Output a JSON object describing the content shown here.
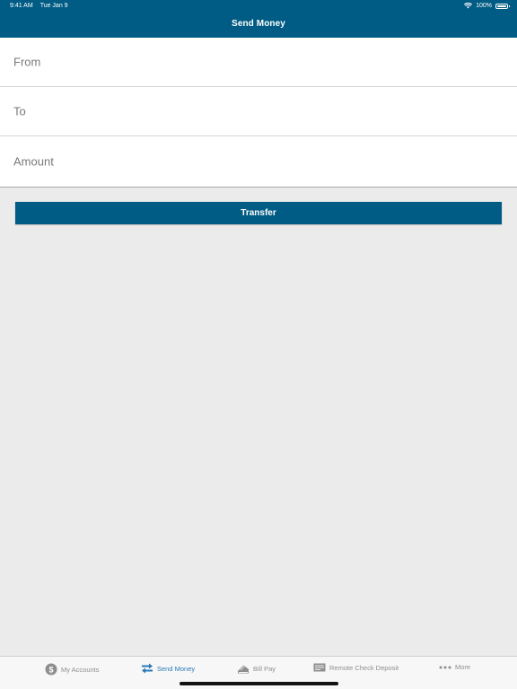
{
  "status_bar": {
    "time": "9:41 AM",
    "date": "Tue Jan 9",
    "battery": "100%"
  },
  "nav": {
    "title": "Send Money"
  },
  "form": {
    "fields": [
      {
        "label": "From"
      },
      {
        "label": "To"
      },
      {
        "label": "Amount"
      }
    ]
  },
  "transfer_button": {
    "label": "Transfer"
  },
  "tabs": [
    {
      "label": "My Accounts",
      "icon": "dollar-icon",
      "active": false
    },
    {
      "label": "Send Money",
      "icon": "transfer-arrows-icon",
      "active": true
    },
    {
      "label": "Bill Pay",
      "icon": "bill-pay-icon",
      "active": false
    },
    {
      "label": "Remote Check Deposit",
      "icon": "check-icon",
      "active": false
    },
    {
      "label": "More",
      "icon": "more-dots-icon",
      "active": false
    }
  ],
  "colors": {
    "brand": "#005c84",
    "active_tab": "#2a7ab8",
    "inactive_tab": "#8e8e8e",
    "background": "#ebebeb"
  }
}
